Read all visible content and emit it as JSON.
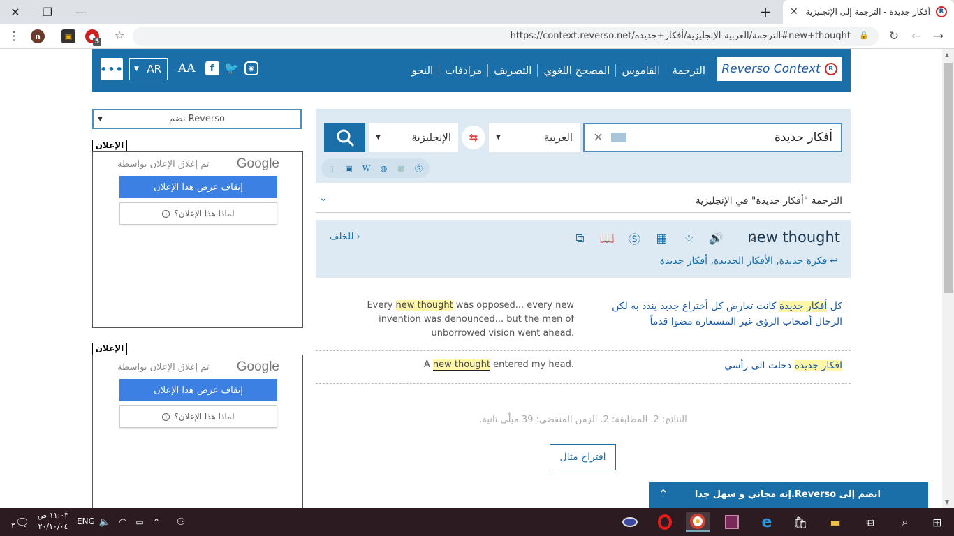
{
  "browser": {
    "tab_title": "أفكار جديدة - الترجمة إلى الإنجليزية",
    "new_tab": "+",
    "url": "https://context.reverso.net/الترجمة/العربية-الإنجليزية/أفكار+جديدة#new+thought",
    "extension_badge": "5",
    "profile_letter": "n"
  },
  "header": {
    "logo_text": "Reverso Context",
    "nav": [
      "الترجمة",
      "القاموس",
      "المصحح اللغوي",
      "التصريف",
      "مرادفات",
      "النحو"
    ],
    "font_size_label": "AA",
    "ui_language": "AR"
  },
  "sidebar": {
    "join_select": "نضم Reverso",
    "ads": [
      {
        "label": "الإعلان",
        "closed_by": "تم إغلاق الإعلان بواسطة",
        "google": "Google",
        "stop_button": "إيقاف عرض هذا الإعلان",
        "why_button": "لماذا هذا الإعلان؟"
      },
      {
        "label": "الإعلان",
        "closed_by": "تم إغلاق الإعلان بواسطة",
        "google": "Google",
        "stop_button": "إيقاف عرض هذا الإعلان",
        "why_button": "لماذا هذا الإعلان؟"
      }
    ]
  },
  "search": {
    "query": "أفكار جديدة",
    "source_lang": "العربية",
    "target_lang": "الإنجليزية"
  },
  "result": {
    "heading": "الترجمة \"أفكار جديدة\" في الإنجليزية",
    "word": "new thought",
    "count": "2",
    "back_label": "للخلف",
    "related": "فكرة جديدة, الأفكار الجديدة, أفكار جديدة"
  },
  "examples": [
    {
      "src_pre": "كل ",
      "src_hl": "أفكار جديدة",
      "src_post": " كانت تعارض كل أختراع جديد يندد به لكن الرجال أصحاب الرؤى غير المستعارة مضوا قدماً",
      "tgt_pre": "Every ",
      "tgt_hl": "new thought",
      "tgt_post": " was opposed... every new invention was denounced... but the men of unborrowed vision went ahead."
    },
    {
      "src_pre": "",
      "src_hl": "افكار جديدة",
      "src_post": " دخلت الى رأسي",
      "tgt_pre": "A ",
      "tgt_hl": "new thought",
      "tgt_post": " entered my head."
    }
  ],
  "stats": "النتائج: 2. المطابقة: 2. الزمن المنقضي: 39 ميلّي ثانية.",
  "suggest_button": "اقتراح مثال",
  "join_bar": "انضم إلى Reverso.إنه مجاني و سهل جدا",
  "taskbar": {
    "time": "١١:٠٣ ص",
    "date": "٢٠/١٠/٠٤",
    "lang": "ENG",
    "notifications": "٣"
  }
}
